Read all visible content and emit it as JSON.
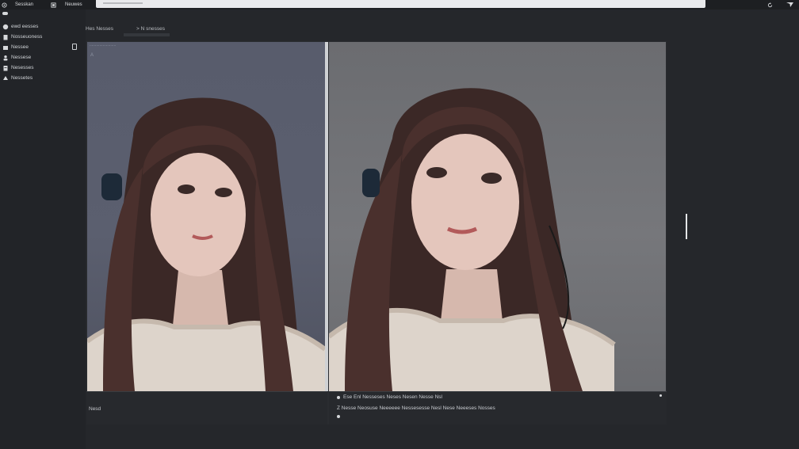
{
  "topbar": {
    "app_label": "Sesskan",
    "tab_label": "Neuwes",
    "address_value": "",
    "refresh_icon": "refresh-icon",
    "menu_icon": "send-icon"
  },
  "sidebar": {
    "items": [
      {
        "label": "ewd eesses",
        "icon": "globe-icon"
      },
      {
        "label": "Nosseuoness",
        "icon": "file-icon"
      },
      {
        "label": "Nessee",
        "icon": "folder-icon"
      },
      {
        "label": "Nessese",
        "icon": "user-icon"
      },
      {
        "label": "Nesesses",
        "icon": "doc-icon"
      },
      {
        "label": "Nessetes",
        "icon": "bell-icon"
      }
    ]
  },
  "breadcrumb": {
    "first": "Hes Nesses",
    "second": "> N snesses"
  },
  "left_image": {
    "label": "........................",
    "mark": "A"
  },
  "captions": {
    "left": "Nesd",
    "right_line1": "Ese Enl Nesseses Neses Nesen Nesse Nsl",
    "right_line2": "Z Nesse Neosuse Neeeeee Nessesesse Nesl Nese Neeeses Nosses"
  },
  "colors": {
    "background": "#25272b",
    "sidebar": "#222428",
    "panel": "#2a2c30",
    "divider": "#cfd1d4",
    "topbar": "#1d1f22"
  }
}
